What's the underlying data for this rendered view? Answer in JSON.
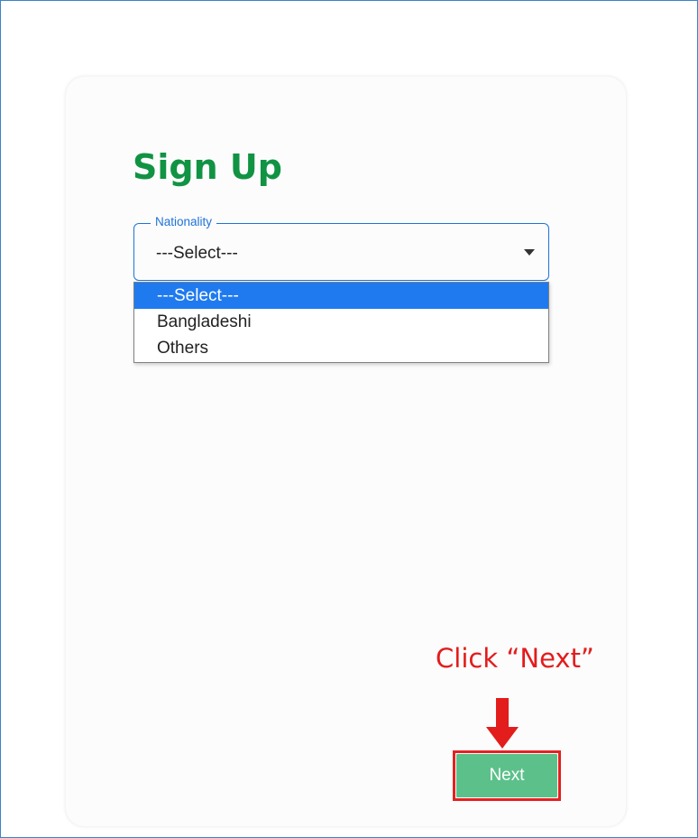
{
  "signup": {
    "title": "Sign Up",
    "nationality": {
      "label": "Nationality",
      "selected": "---Select---",
      "options": [
        "---Select---",
        "Bangladeshi",
        "Others"
      ]
    },
    "next_label": "Next"
  },
  "annotation": {
    "text": "Click “Next”",
    "color": "#e31c1c"
  },
  "colors": {
    "title": "#119344",
    "accent_blue": "#1f73d9",
    "option_highlight": "#1f7af0",
    "next_button": "#5cc08b",
    "highlight_box": "#e52121"
  }
}
